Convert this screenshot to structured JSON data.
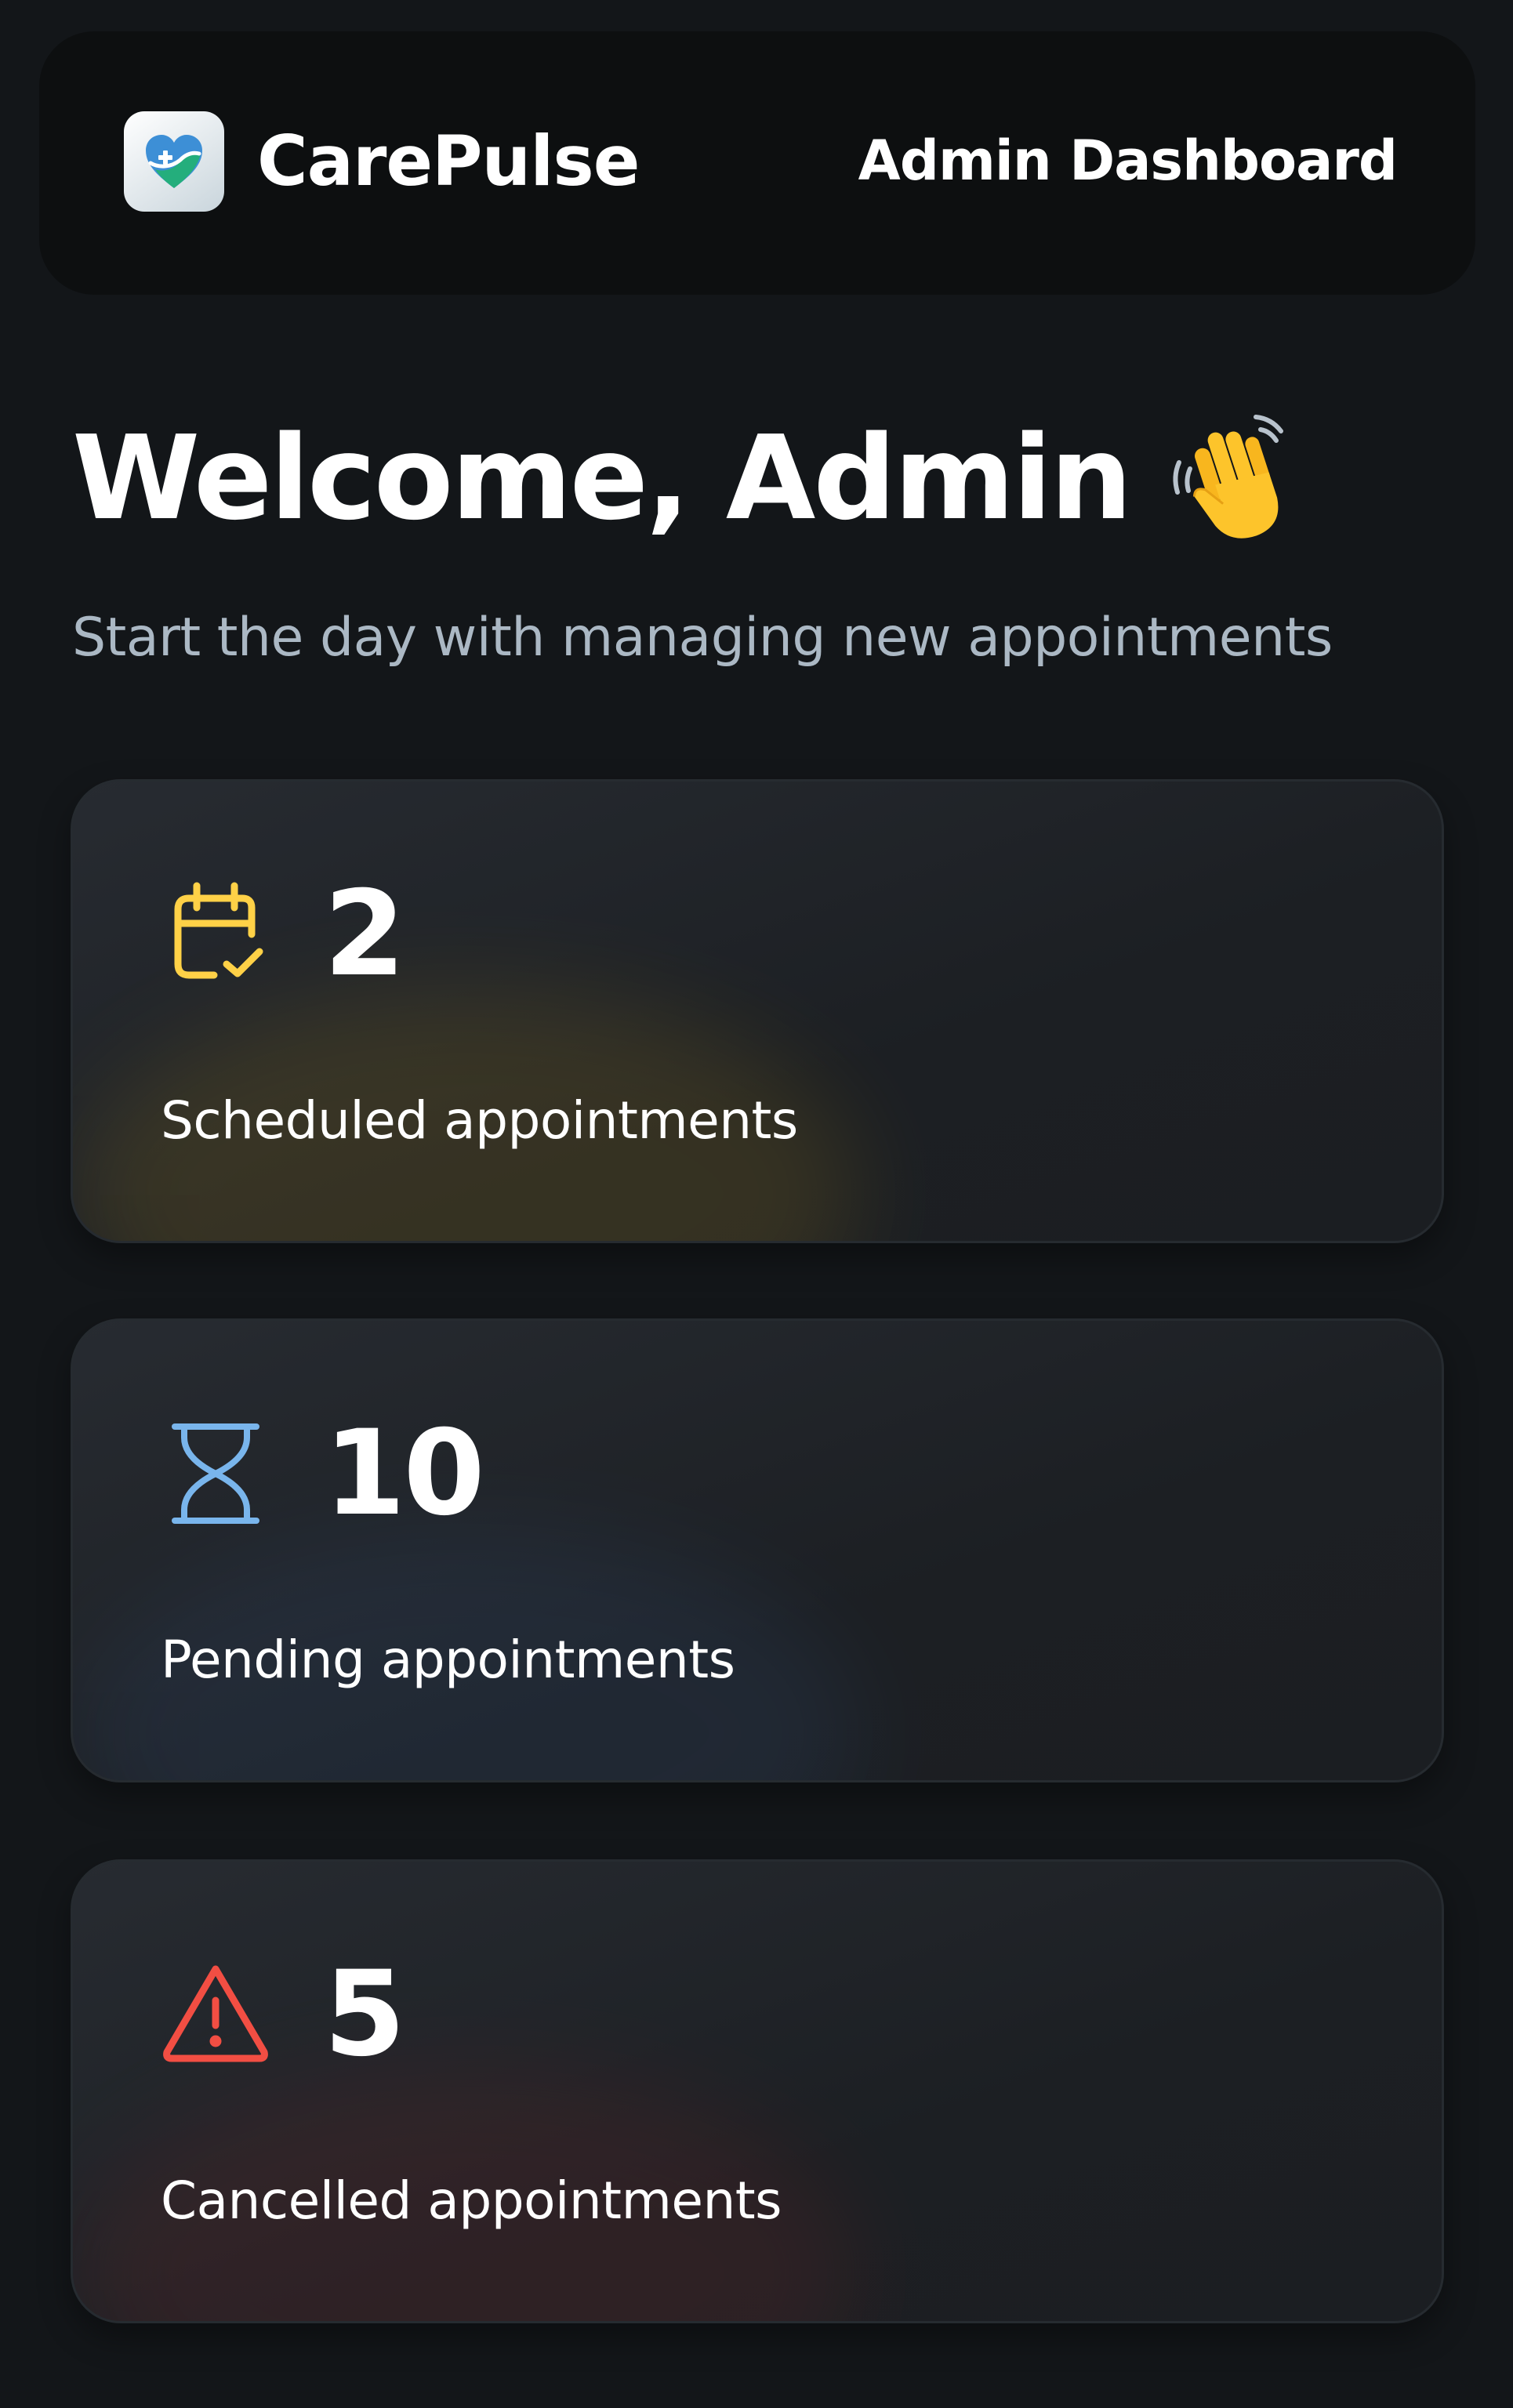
{
  "header": {
    "brand_name": "CarePulse",
    "title": "Admin Dashboard"
  },
  "welcome": {
    "title": "Welcome, Admin",
    "subtitle": "Start the day with managing new appointments"
  },
  "stats": [
    {
      "count": "2",
      "label": "Scheduled appointments",
      "icon": "calendar-check-icon",
      "color": "#FFD147"
    },
    {
      "count": "10",
      "label": "Pending appointments",
      "icon": "hourglass-icon",
      "color": "#79B5EC"
    },
    {
      "count": "5",
      "label": "Cancelled appointments",
      "icon": "warning-icon",
      "color": "#F24E43"
    }
  ],
  "colors": {
    "background": "#131619",
    "header_bg": "#0D0F10",
    "subtitle": "#ABB8C4",
    "brand_green": "#24AE7C"
  }
}
